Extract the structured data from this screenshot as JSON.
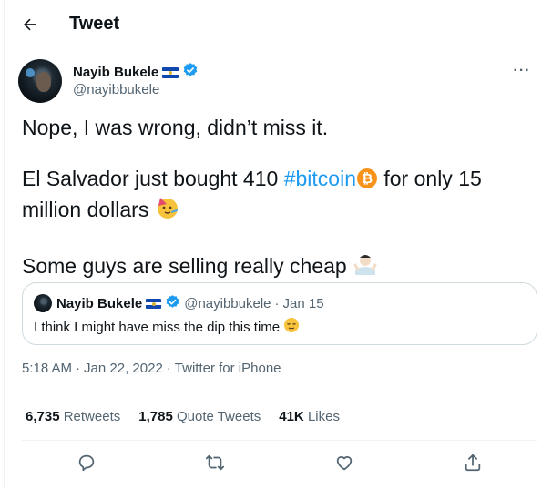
{
  "header": {
    "title": "Tweet",
    "back_icon": "arrow-left-icon"
  },
  "author": {
    "display_name": "Nayib Bukele",
    "handle": "@nayibbukele",
    "flag_icon": "el-salvador-flag-icon",
    "verified_icon": "verified-badge-icon"
  },
  "more_icon": "more-options-icon",
  "tweet": {
    "line1": "Nope, I was wrong, didn’t miss it.",
    "line2_pre": "El Salvador just bought 410 ",
    "hashtag": "#bitcoin",
    "line2_post": " for only 15 million dollars",
    "line3": "Some guys are selling really cheap",
    "emojis": [
      "bitcoin-logo-icon",
      "party-face-emoji",
      "shrugging-man-emoji"
    ]
  },
  "quote": {
    "display_name": "Nayib Bukele",
    "handle": "@nayibbukele",
    "separator": "·",
    "date": "Jan 15",
    "text": "I think I might have miss the dip this time",
    "emoji": "relieved-face-emoji"
  },
  "meta": {
    "time": "5:18 AM",
    "sep1": "·",
    "date": "Jan 22, 2022",
    "sep2": "·",
    "source": "Twitter for iPhone"
  },
  "stats": [
    {
      "count": "6,735",
      "label": "Retweets"
    },
    {
      "count": "1,785",
      "label": "Quote Tweets"
    },
    {
      "count": "41K",
      "label": "Likes"
    }
  ],
  "actions": [
    "reply-icon",
    "retweet-icon",
    "like-icon",
    "share-icon"
  ],
  "colors": {
    "accent": "#1d9bf0",
    "muted": "#536471",
    "text": "#0f1419",
    "border": "#cfd9de",
    "divider": "#eff3f4"
  }
}
